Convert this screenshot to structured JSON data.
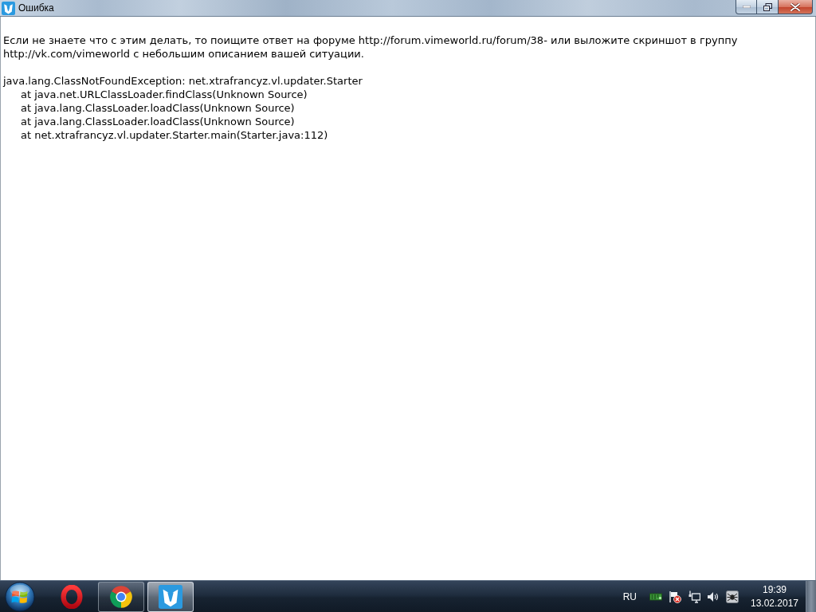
{
  "window": {
    "title": "Ошибка"
  },
  "error": {
    "message": "Если не знаете что с этим делать, то поищите ответ на форуме http://forum.vimeworld.ru/forum/38- или выложите скриншот в группу http://vk.com/vimeworld с небольшим описанием вашей ситуации.",
    "exception": "java.lang.ClassNotFoundException: net.xtrafrancyz.vl.updater.Starter",
    "stack_trace": [
      "at java.net.URLClassLoader.findClass(Unknown Source)",
      "at java.lang.ClassLoader.loadClass(Unknown Source)",
      "at java.lang.ClassLoader.loadClass(Unknown Source)",
      "at net.xtrafrancyz.vl.updater.Starter.main(Starter.java:112)"
    ]
  },
  "taskbar": {
    "apps": [
      {
        "kind": "ring",
        "running": false,
        "selected": false
      },
      {
        "kind": "wheel",
        "running": true,
        "selected": false
      },
      {
        "kind": "mascot",
        "running": true,
        "selected": true
      }
    ],
    "tray": {
      "language": "RU",
      "time": "19:39",
      "date": "13.02.2017"
    }
  }
}
